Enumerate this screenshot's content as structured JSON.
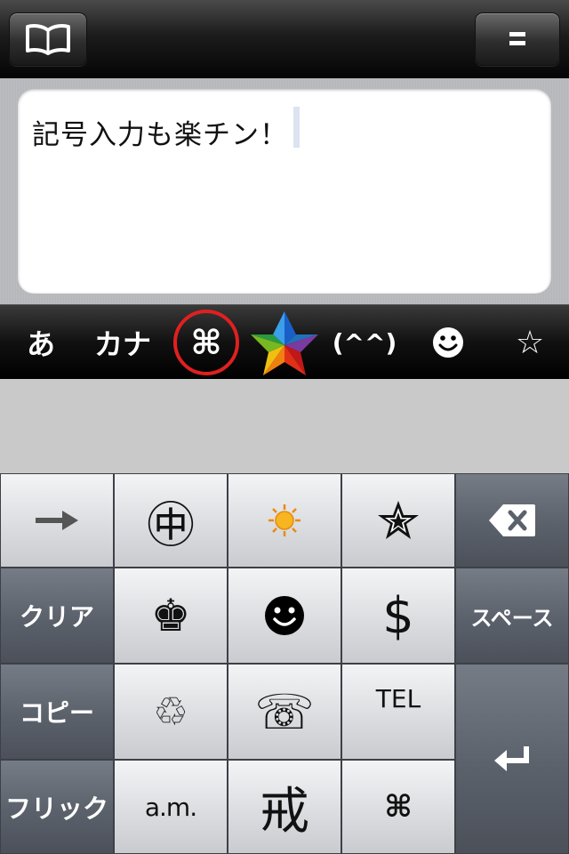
{
  "navbar": {
    "left_button": "book-icon",
    "right_button": "menu-icon"
  },
  "editor": {
    "text": "記号入力も楽チン！"
  },
  "modes": [
    {
      "label": "あ"
    },
    {
      "label": "カナ"
    },
    {
      "label": "⌘"
    },
    {
      "label": "(^^)"
    },
    {
      "label": "☆"
    }
  ],
  "keys": {
    "arrow": "→",
    "naka": "㊥",
    "sun": "☀",
    "star_black": "✮",
    "clear": "クリア",
    "king": "♚",
    "smiley": "☻",
    "dollar": "$",
    "space": "スペース",
    "copy": "コピー",
    "recycle": "♲",
    "telephone": "☏",
    "tel": "TEL",
    "flick": "フリック",
    "am": "a.m.",
    "kanji": "戒",
    "command": "⌘"
  },
  "colors": {
    "highlight_ring": "#e02020",
    "key_light": "#e4e5e8",
    "key_dark": "#5e646e",
    "caret": "#dce3f1"
  }
}
